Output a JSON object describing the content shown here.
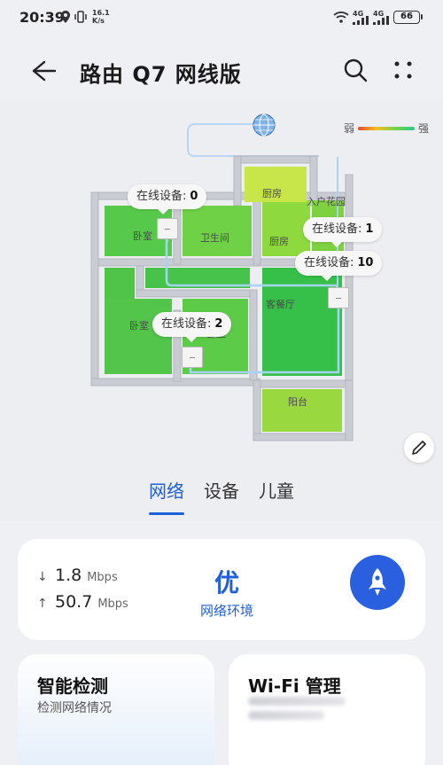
{
  "status_bar": {
    "time": "20:39",
    "speed_value": "16.1",
    "speed_unit": "K/s",
    "network_1": "4G",
    "network_2": "4G",
    "battery": "66"
  },
  "header": {
    "title": "路由 Q7 网线版"
  },
  "map": {
    "legend_weak": "弱",
    "legend_strong": "强",
    "rooms": {
      "kitchen_top": "厨房",
      "entry_garden": "入户花园",
      "bedroom_1": "卧室",
      "bathroom": "卫生间",
      "kitchen": "厨房",
      "living_dining": "客餐厅",
      "bedroom_2": "卧室",
      "bedroom_3": "卧室",
      "balcony": "阳台"
    },
    "bubbles": [
      {
        "label": "在线设备:",
        "count": "0"
      },
      {
        "label": "在线设备:",
        "count": "1"
      },
      {
        "label": "在线设备:",
        "count": "10"
      },
      {
        "label": "在线设备:",
        "count": "2"
      }
    ]
  },
  "tabs": [
    {
      "label": "网络",
      "active": true
    },
    {
      "label": "设备",
      "active": false
    },
    {
      "label": "儿童",
      "active": false
    }
  ],
  "status_card": {
    "download_value": "1.8",
    "download_unit": "Mbps",
    "upload_value": "50.7",
    "upload_unit": "Mbps",
    "quality_value": "优",
    "quality_label": "网络环境"
  },
  "cards": {
    "detect_title": "智能检测",
    "detect_sub": "检测网络情况",
    "wifi_title": "Wi-Fi 管理"
  },
  "colors": {
    "accent": "#1f5fd8",
    "boost_button": "#2a5fe0",
    "signal_strong": "#2ec98d",
    "signal_weak": "#e54a3a"
  }
}
